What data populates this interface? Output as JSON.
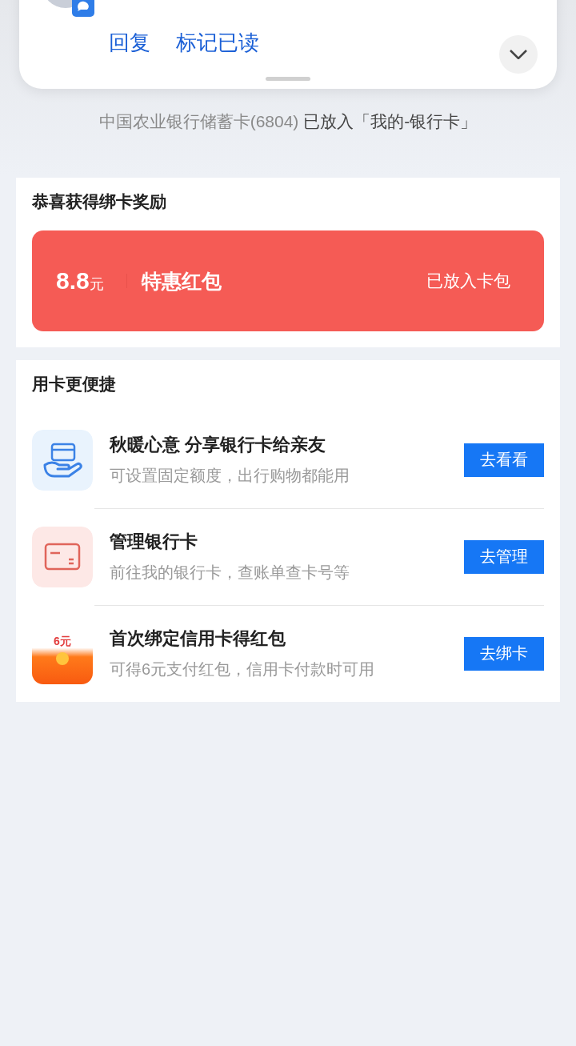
{
  "notification": {
    "actions": [
      "回复",
      "标记已读"
    ]
  },
  "bind_result": {
    "card": "中国农业银行储蓄卡(6804)",
    "status": "已放入「我的-银行卡」"
  },
  "reward": {
    "title": "恭喜获得绑卡奖励",
    "amount": "8.8",
    "unit": "元",
    "name": "特惠红包",
    "status": "已放入卡包"
  },
  "shortcuts": {
    "title": "用卡更便捷",
    "items": [
      {
        "kind": "share",
        "title": "秋暖心意 分享银行卡给亲友",
        "subtitle": "可设置固定额度，出行购物都能用",
        "button": "去看看"
      },
      {
        "kind": "card",
        "title": "管理银行卡",
        "subtitle": "前往我的银行卡，查账单查卡号等",
        "button": "去管理"
      },
      {
        "kind": "packet",
        "icon_label": "6元",
        "title": "首次绑定信用卡得红包",
        "subtitle": "可得6元支付红包，信用卡付款时可用",
        "button": "去绑卡"
      }
    ]
  }
}
